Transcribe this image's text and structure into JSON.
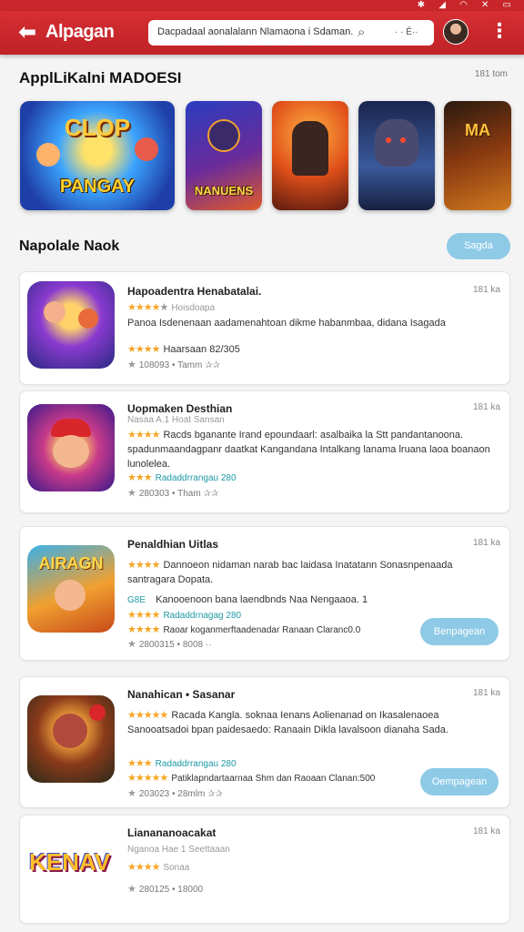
{
  "status_bar": {
    "icons": [
      "bluetooth-icon",
      "signal-icon",
      "wifi-icon",
      "network-icon",
      "battery-icon"
    ]
  },
  "appbar": {
    "title": "Alpagan",
    "search_placeholder": "Dacpadaal aonalalann Nlamaona i Sdaman.",
    "voice_label": "· · Ē··",
    "accent": "#c8262b"
  },
  "featured": {
    "title": "ApplLiKalni MADOESI",
    "meta": "181 tom",
    "items": [
      {
        "caption": "PANGAY",
        "top": "CLOP"
      },
      {
        "caption": "NANUENS",
        "top": ""
      },
      {
        "caption": "",
        "top": ""
      },
      {
        "caption": "",
        "top": ""
      },
      {
        "caption": "",
        "top": "MA"
      }
    ]
  },
  "list_section": {
    "title": "Napolale Naok",
    "see_all": "Sagda"
  },
  "apps": [
    {
      "name": "Hapoadentra Henabatalai.",
      "time": "181 ka",
      "rating_text": "Hoisdoapa",
      "description": "Panoa Isdenenaan aadamenahtoan dikme habanmbaa, didana Isagada",
      "line2": "Haarsaan 82/305",
      "downloads": "108093 • Tamm",
      "action": ""
    },
    {
      "name": "Uopmaken Desthian",
      "time": "181 ka",
      "subtitle": "Nasaa  A.1  Hoat Sansan",
      "description": "Racds bganante Irand epoundaarl: asalbaika la Stt pandantanoona. spadunmaandagpanr daatkat Kangandana Intalkang lanama lruana laoa boanaon lunolelea.",
      "link_text": "Radaddrrangau 280",
      "downloads": "280303 • Tham",
      "action": ""
    },
    {
      "name": "Penaldhian Uitlas",
      "time": "181 ka",
      "description": "Dannoeon nidaman  narab bac laidasa Inatatann Sonasnpenaada santragara Dopata.",
      "tag": "G8E",
      "tag_line": "Kanooenoon bana laendbnds Naa Nengaaoa. 1",
      "link_text": "Radaddrnagag 280",
      "line_extra": "Raoar koganmerftaadenadar Ranaan Claranc0.0",
      "downloads": "2800315 • 8008 ··",
      "action": "Benpagean"
    },
    {
      "name": "Nanahican • Sasanar",
      "time": "181 ka",
      "description": "Racada Kangla. soknaa Ienans Aolienanad on Ikasalenaoea Sanooatsadoi bpan paidesaedo: Ranaain Dikla lavalsoon dianaha Sada.",
      "link_text": "Radaddrrangau 280",
      "line_extra": "Patiklapndartaarnaa Shm dan Raoaan Clanan:500",
      "downloads": "203023 • 28mlm",
      "action": "Oempagean"
    },
    {
      "name": "Lianananoacakat",
      "time": "181 ka",
      "subtitle": "Nganoa Hae  1  Seettaaan",
      "rating_text": "Sonaa",
      "downloads": "280125 • 18000",
      "action": ""
    }
  ]
}
